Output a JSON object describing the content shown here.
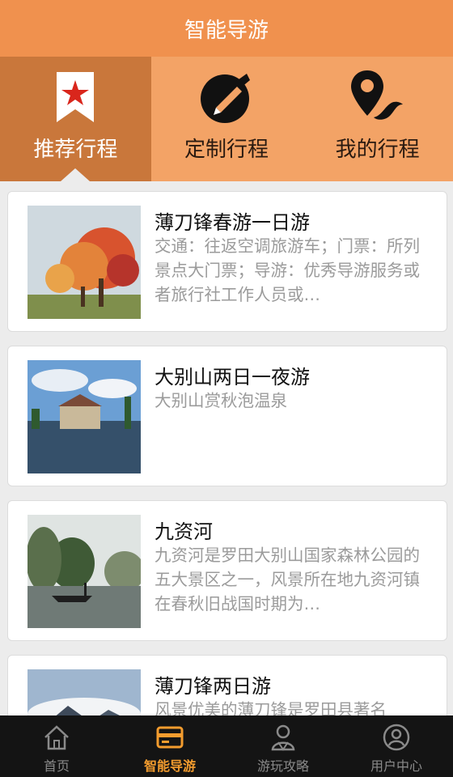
{
  "header": {
    "title": "智能导游"
  },
  "tabs": [
    {
      "label": "推荐行程",
      "icon": "bookmark-star-icon",
      "active": true
    },
    {
      "label": "定制行程",
      "icon": "pencil-circle-icon",
      "active": false
    },
    {
      "label": "我的行程",
      "icon": "location-pin-icon",
      "active": false
    }
  ],
  "trips": [
    {
      "title": "薄刀锋春游一日游",
      "desc": "交通：往返空调旅游车；门票：所列景点大门票；导游：优秀导游服务或者旅行社工作人员或…",
      "thumb": "autumn-trees-photo"
    },
    {
      "title": "大别山两日一夜游",
      "desc": "大别山赏秋泡温泉",
      "thumb": "lakeside-resort-photo"
    },
    {
      "title": "九资河",
      "desc": "九资河是罗田大别山国家森林公园的五大景区之一，风景所在地九资河镇在春秋旧战国时期为…",
      "thumb": "misty-river-boat-photo"
    },
    {
      "title": "薄刀锋两日游",
      "desc": "风景优美的薄刀锋是罗田县著名",
      "thumb": "mountain-clouds-photo"
    }
  ],
  "bottom_nav": [
    {
      "label": "首页",
      "icon": "home-icon",
      "active": false
    },
    {
      "label": "智能导游",
      "icon": "card-icon",
      "active": true
    },
    {
      "label": "游玩攻略",
      "icon": "people-icon",
      "active": false
    },
    {
      "label": "用户中心",
      "icon": "user-circle-icon",
      "active": false
    }
  ],
  "colors": {
    "header_bg": "#f0914e",
    "tabs_bg": "#f3a366",
    "tab_active_bg": "#c9773b",
    "nav_bg": "#141414",
    "nav_active": "#f39c2e"
  }
}
